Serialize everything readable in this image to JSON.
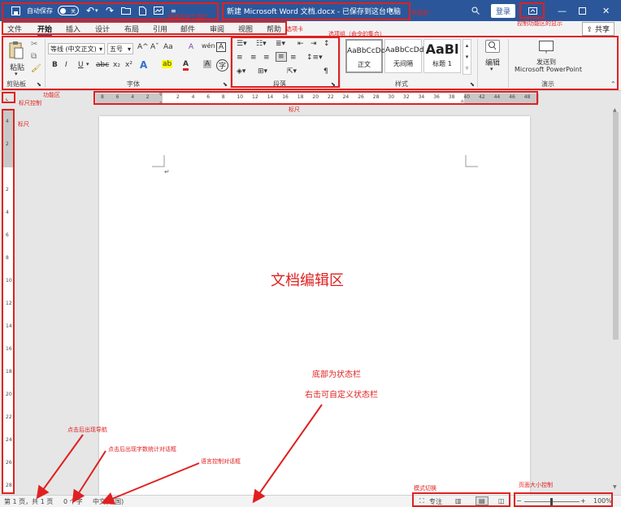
{
  "titlebar": {
    "autosave_label": "自动保存",
    "autosave_state": "关",
    "doc_title": "新建 Microsoft Word 文档.docx - 已保存到这台电脑",
    "login": "登录"
  },
  "tabs": [
    "文件",
    "开始",
    "插入",
    "设计",
    "布局",
    "引用",
    "邮件",
    "审阅",
    "视图",
    "帮助"
  ],
  "share": "共享",
  "ribbon": {
    "clipboard": {
      "paste": "粘贴",
      "label": "剪贴板"
    },
    "font": {
      "font_name": "等线 (中文正文)",
      "font_size": "五号",
      "label": "字体",
      "buttons": {
        "bold": "B",
        "italic": "I",
        "underline": "U",
        "strike": "abc",
        "sub": "x₂",
        "sup": "x²",
        "grow": "A^",
        "shrink": "Aˇ",
        "case": "Aa",
        "color": "A",
        "highlight": "ab",
        "char_shade": "A",
        "enclose": "A",
        "clear": "A",
        "pinyin": "wén"
      }
    },
    "paragraph": {
      "label": "段落"
    },
    "styles": {
      "label": "样式",
      "items": [
        {
          "preview": "AaBbCcDd",
          "name": "正文"
        },
        {
          "preview": "AaBbCcDd",
          "name": "无间隔"
        },
        {
          "preview": "AaBl",
          "name": "标题 1"
        }
      ]
    },
    "editing": {
      "label": "编辑"
    },
    "present": {
      "action": "发送到",
      "target": "Microsoft PowerPoint",
      "label": "演示"
    }
  },
  "hruler_ticks": [
    "8",
    "6",
    "4",
    "2",
    "",
    "2",
    "4",
    "6",
    "8",
    "10",
    "12",
    "14",
    "16",
    "18",
    "20",
    "22",
    "24",
    "26",
    "28",
    "30",
    "32",
    "34",
    "36",
    "38",
    "40",
    "42",
    "44",
    "46",
    "48"
  ],
  "vruler_ticks": [
    "4",
    "2",
    "",
    "2",
    "4",
    "6",
    "8",
    "10",
    "12",
    "14",
    "16",
    "18",
    "20",
    "22",
    "24",
    "26",
    "28"
  ],
  "statusbar": {
    "pages": "第 1 页，共 1 页",
    "words": "0 个字",
    "language": "中文(中国)",
    "focus": "专注",
    "zoom": "100%"
  },
  "annotations": {
    "quick_access": "快速访问工具栏",
    "title_bar": "标题栏",
    "tab_card": "选项卡",
    "ribbon_display": "控制功能区的显示",
    "option_group": "选项组（命令的集合）",
    "function_area": "功能区",
    "ruler_control": "标尺控制",
    "ruler_h": "标尺",
    "ruler_v": "标尺",
    "doc_area": "文档编辑区",
    "bottom_status": "底部为状态栏",
    "right_custom": "右击可自定义状态栏",
    "nav_click": "点击后出现导航",
    "word_count_click": "点击后出现字数统计对话框",
    "lang_dialog": "语言控制对话框",
    "mode_switch": "模式切换",
    "zoom_control": "页面大小控制"
  }
}
